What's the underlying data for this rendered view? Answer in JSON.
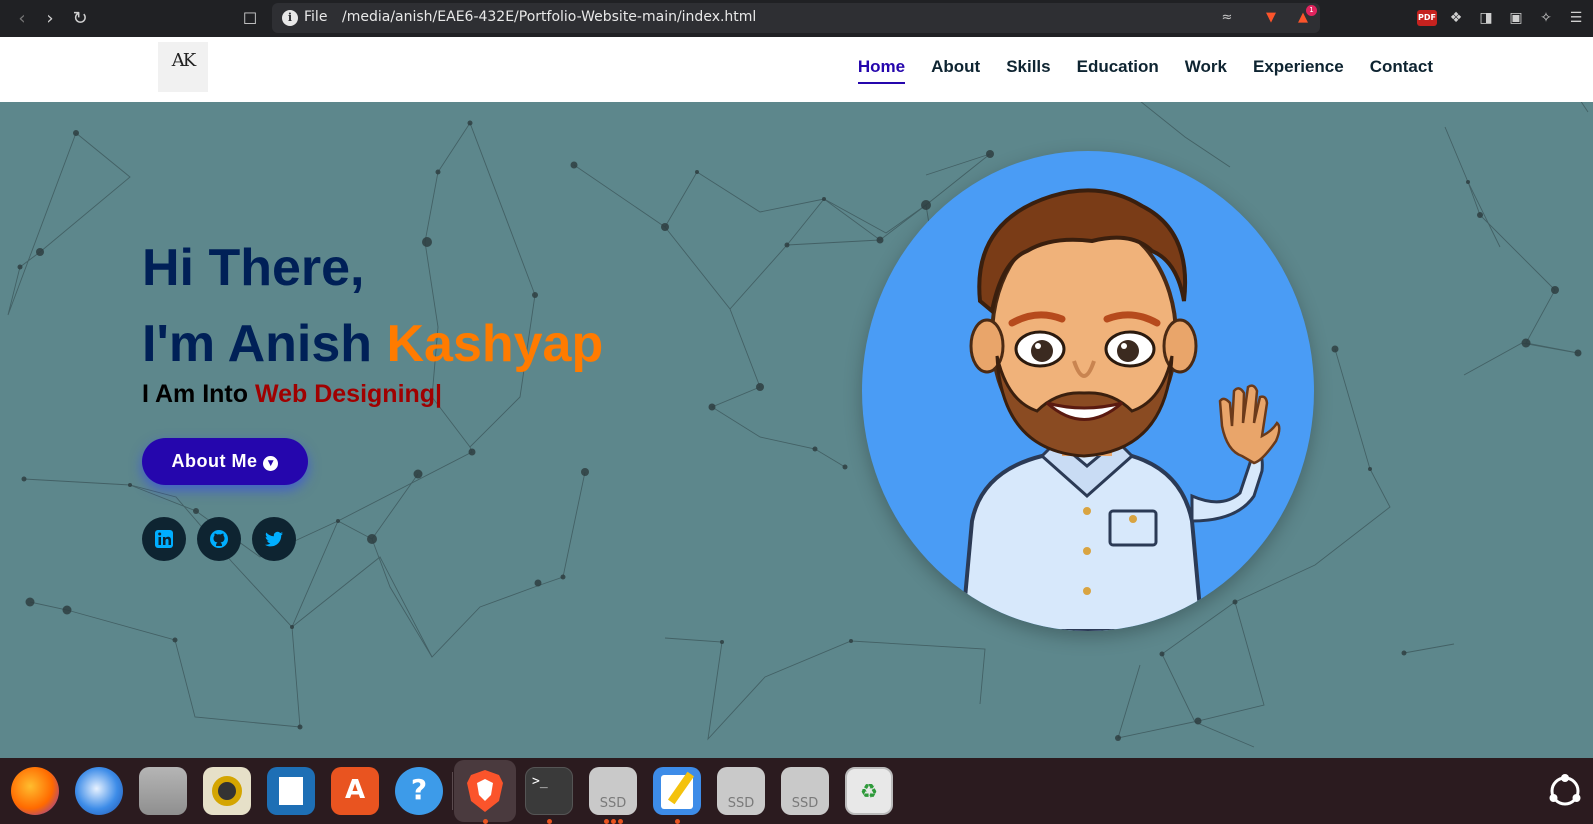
{
  "browser": {
    "url_scheme": "File",
    "url": "/media/anish/EAE6-432E/Portfolio-Website-main/index.html",
    "notification_count": "1",
    "pdf_label": "PDF"
  },
  "navbar": {
    "logo_text": "AK",
    "links": [
      "Home",
      "About",
      "Skills",
      "Education",
      "Work",
      "Experience",
      "Contact"
    ],
    "active": "Home"
  },
  "hero": {
    "greeting": "Hi There,",
    "name_prefix": "I'm Anish ",
    "name_accent": "Kashyap",
    "into_label": "I Am Into ",
    "typed_text": "Web Designing|",
    "button_label": "About Me",
    "social": [
      "linkedin-icon",
      "github-icon",
      "twitter-icon"
    ]
  },
  "dock": {
    "apps": [
      "firefox",
      "thunderbird",
      "files",
      "rhythmbox",
      "libreoffice-writer",
      "app-center",
      "help",
      "brave",
      "terminal",
      "ssd-drive",
      "text-editor",
      "ssd-drive",
      "ssd-drive",
      "trash"
    ],
    "ssd_label": "SSD"
  },
  "colors": {
    "background": "#5d878c",
    "accent": "#ff7b00",
    "title": "#002057",
    "button": "#2506ad",
    "typed": "#a00000"
  }
}
